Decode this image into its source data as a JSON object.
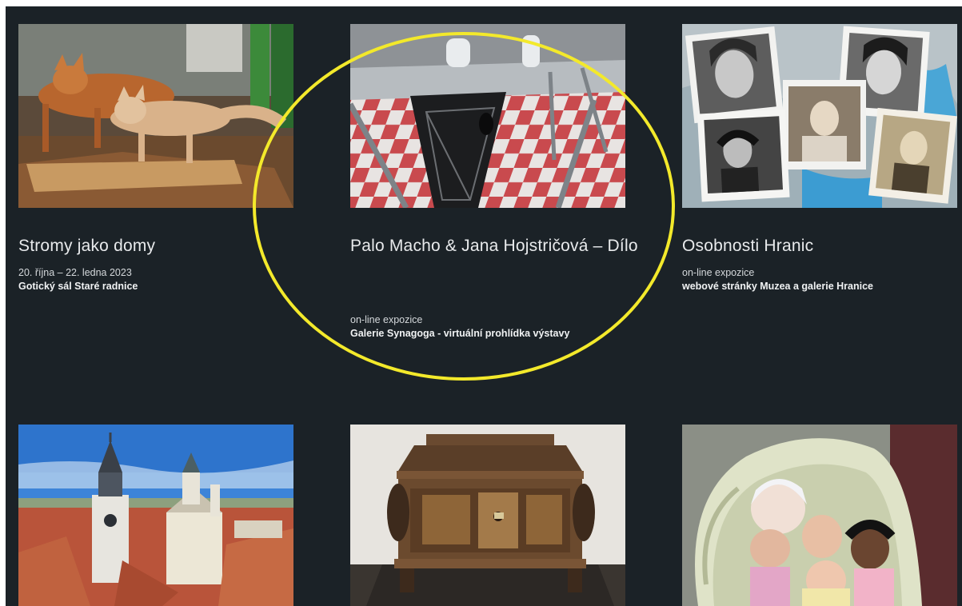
{
  "exhibitions": [
    {
      "title": "Stromy jako domy",
      "date": "20. října – 22. ledna 2023",
      "location": "Gotický sál Staré radnice",
      "image_icon": "fox-taxidermy-photo"
    },
    {
      "title": "Palo Macho & Jana Hojstričová – Dílo",
      "date": "on-line expozice",
      "location": "Galerie Synagoga - virtuální prohlídka výstavy",
      "image_icon": "glass-showcase-photo"
    },
    {
      "title": "Osobnosti Hranic",
      "date": "on-line expozice",
      "location": "webové stránky Muzea a galerie Hranice",
      "image_icon": "portrait-photos-collage"
    }
  ],
  "bottom_row": [
    {
      "image_icon": "town-aerial-photo"
    },
    {
      "image_icon": "wooden-chest-photo"
    },
    {
      "image_icon": "dolls-in-pram-photo"
    }
  ],
  "colors": {
    "background": "#1b2227",
    "highlight_circle": "#f3e92b"
  }
}
